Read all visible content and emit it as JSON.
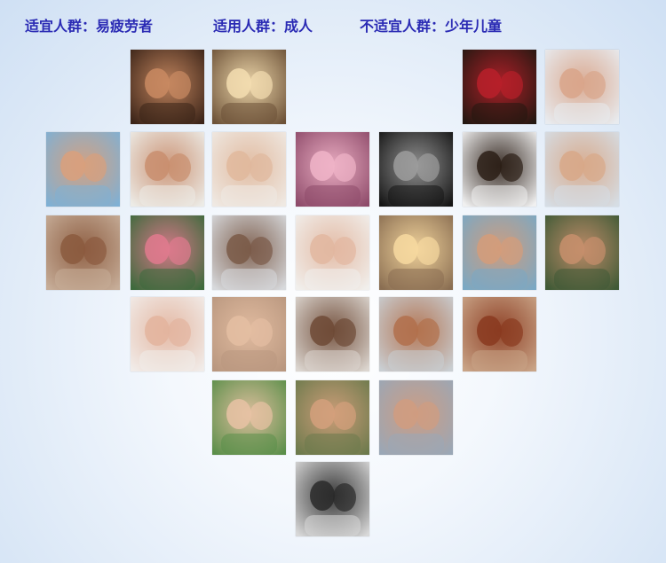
{
  "header": {
    "suitable": "适宜人群：易疲劳者",
    "applicable": "适用人群：成人",
    "unsuitable": "不适宜人群：少年儿童"
  },
  "colors": {
    "header_text": "#2a2ab4"
  },
  "photos": [
    {
      "name": "photo-couple-embrace-dark",
      "row": 0,
      "col": 1,
      "bg": "#3b2418",
      "fg": "#c98a62"
    },
    {
      "name": "photo-couple-silhouette-sunset",
      "row": 0,
      "col": 2,
      "bg": "#6d5238",
      "fg": "#f3ddb0"
    },
    {
      "name": "photo-woman-with-rose",
      "row": 0,
      "col": 5,
      "bg": "#231811",
      "fg": "#b8202a"
    },
    {
      "name": "photo-couple-smiling-bed",
      "row": 0,
      "col": 6,
      "bg": "#e8ebef",
      "fg": "#d9a58a"
    },
    {
      "name": "photo-couple-cuddling",
      "row": 1,
      "col": 0,
      "bg": "#7fb0d4",
      "fg": "#d9a07c"
    },
    {
      "name": "photo-couple-laughing-bed",
      "row": 1,
      "col": 1,
      "bg": "#ecebe6",
      "fg": "#c98e6e"
    },
    {
      "name": "photo-holding-hands",
      "row": 1,
      "col": 2,
      "bg": "#efe9e3",
      "fg": "#e0b89c"
    },
    {
      "name": "photo-woman-flowers",
      "row": 1,
      "col": 3,
      "bg": "#8e4b6a",
      "fg": "#f0b4c8"
    },
    {
      "name": "photo-couple-kiss-bw",
      "row": 1,
      "col": 4,
      "bg": "#151515",
      "fg": "#9c9c9c"
    },
    {
      "name": "photo-man-muscle-silhouette",
      "row": 1,
      "col": 5,
      "bg": "#f0f0f0",
      "fg": "#2b1e16"
    },
    {
      "name": "photo-legs-window",
      "row": 1,
      "col": 6,
      "bg": "#d6dde4",
      "fg": "#d8a888"
    },
    {
      "name": "photo-couple-nose-touch",
      "row": 2,
      "col": 0,
      "bg": "#c6ad98",
      "fg": "#8b5a3e"
    },
    {
      "name": "photo-flower-garden",
      "row": 2,
      "col": 1,
      "bg": "#3d6a3c",
      "fg": "#e07a8e"
    },
    {
      "name": "photo-woman-pillow",
      "row": 2,
      "col": 2,
      "bg": "#d7d9dc",
      "fg": "#7a5a48"
    },
    {
      "name": "photo-feet-bed",
      "row": 2,
      "col": 3,
      "bg": "#f1efec",
      "fg": "#e2b7a0"
    },
    {
      "name": "photo-couple-beach-sunset",
      "row": 2,
      "col": 4,
      "bg": "#8a6e52",
      "fg": "#f7d9a0"
    },
    {
      "name": "photo-couple-laughing-close",
      "row": 2,
      "col": 5,
      "bg": "#7aa8c4",
      "fg": "#d49c7a"
    },
    {
      "name": "photo-adam-eve-garden",
      "row": 2,
      "col": 6,
      "bg": "#3f5a36",
      "fg": "#c78f6c"
    },
    {
      "name": "photo-woman-hearts",
      "row": 3,
      "col": 1,
      "bg": "#f1ece9",
      "fg": "#e3b49e"
    },
    {
      "name": "photo-clasped-hands",
      "row": 3,
      "col": 2,
      "bg": "#b9977f",
      "fg": "#e4bea2"
    },
    {
      "name": "photo-couple-almost-kiss",
      "row": 3,
      "col": 3,
      "bg": "#dcd6d0",
      "fg": "#6e4a36"
    },
    {
      "name": "photo-man-back-towel",
      "row": 3,
      "col": 4,
      "bg": "#c9ced2",
      "fg": "#b2704c"
    },
    {
      "name": "photo-redhead-woman",
      "row": 3,
      "col": 5,
      "bg": "#c9a487",
      "fg": "#8a3a20"
    },
    {
      "name": "photo-mature-couple-outdoors",
      "row": 4,
      "col": 2,
      "bg": "#5b8f4a",
      "fg": "#e8c2a4"
    },
    {
      "name": "photo-couple-smiling-outdoors",
      "row": 4,
      "col": 3,
      "bg": "#6c7a4c",
      "fg": "#d4a07c"
    },
    {
      "name": "photo-couple-tender",
      "row": 4,
      "col": 4,
      "bg": "#9aa7b6",
      "fg": "#d09c80"
    },
    {
      "name": "photo-couple-kiss-bw-bottom",
      "row": 5,
      "col": 3,
      "bg": "#d8d8d8",
      "fg": "#2a2a2a"
    }
  ]
}
